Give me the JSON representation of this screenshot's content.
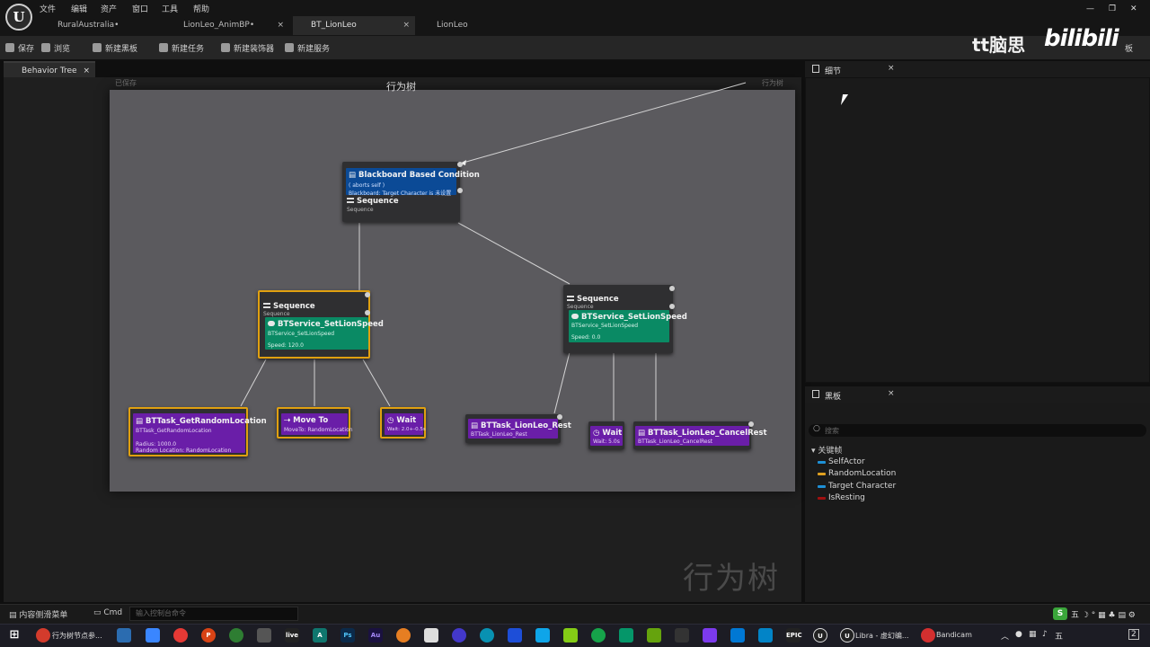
{
  "menu": {
    "file": "文件",
    "edit": "编辑",
    "assets": "资产",
    "window": "窗口",
    "tools": "工具",
    "help": "帮助"
  },
  "tabs": [
    {
      "label": "RuralAustralia•"
    },
    {
      "label": "LionLeo_AnimBP•"
    },
    {
      "label": "BT_LionLeo"
    },
    {
      "label": "LionLeo"
    }
  ],
  "toolbar": {
    "save": "保存",
    "browse": "浏览",
    "new_blackboard": "新建黑板",
    "new_task": "新建任务",
    "new_decorator": "新建装饰器",
    "new_service": "新建服务",
    "right_label": "板"
  },
  "watermark": {
    "brand": "tt脑思",
    "site": "bilibili"
  },
  "editor": {
    "tab_label": "Behavior Tree",
    "graph_title": "行为树",
    "graph_watermark": "行为树",
    "top_left_note": "已保存",
    "top_right_note": "行为树"
  },
  "nodes": {
    "root": {
      "decorator_title": "Blackboard Based Condition",
      "decorator_line1": "( aborts self )",
      "decorator_line2": "Blackboard: Target Character is 未设置",
      "title": "Sequence",
      "subtitle": "Sequence"
    },
    "left_seq": {
      "title": "Sequence",
      "subtitle": "Sequence",
      "service_title": "BTService_SetLionSpeed",
      "service_sub": "BTService_SetLionSpeed",
      "service_param": "Speed: 120.0"
    },
    "right_seq": {
      "title": "Sequence",
      "subtitle": "Sequence",
      "service_title": "BTService_SetLionSpeed",
      "service_sub": "BTService_SetLionSpeed",
      "service_param": "Speed: 0.0"
    },
    "task_random": {
      "title": "BTTask_GetRandomLocation",
      "sub": "BTTask_GetRandomLocation",
      "param1": "Radius: 1000.0",
      "param2": "Random Location: RandomLocation"
    },
    "task_move": {
      "title": "Move To",
      "sub": "MoveTo: RandomLocation"
    },
    "task_wait1": {
      "title": "Wait",
      "sub": "Wait: 2.0+-0.5s"
    },
    "task_rest": {
      "title": "BTTask_LionLeo_Rest",
      "sub": "BTTask_LionLeo_Rest"
    },
    "task_wait2": {
      "title": "Wait",
      "sub": "Wait: 5.0s"
    },
    "task_cancel": {
      "title": "BTTask_LionLeo_CancelRest",
      "sub": "BTTask_LionLeo_CancelRest"
    }
  },
  "details": {
    "tab_label": "细节"
  },
  "blackboard": {
    "tab_label": "黑板",
    "search_placeholder": "搜索",
    "section": "关键帧",
    "keys": [
      {
        "name": "SelfActor",
        "color": "#1e90d6"
      },
      {
        "name": "RandomLocation",
        "color": "#e0a020"
      },
      {
        "name": "Target Character",
        "color": "#1e90d6"
      },
      {
        "name": "IsResting",
        "color": "#a01010"
      }
    ]
  },
  "statusbar": {
    "content_drawer": "内容侧滑菜单",
    "cmd": "Cmd",
    "cmd_placeholder": "输入控制台命令"
  },
  "taskbar": {
    "chrome_label": "行为树节点参...",
    "libra_label": "Libra - 虚幻编...",
    "bandicam_label": "Bandicam",
    "tray_ime": "五",
    "tray_notif": "2"
  }
}
